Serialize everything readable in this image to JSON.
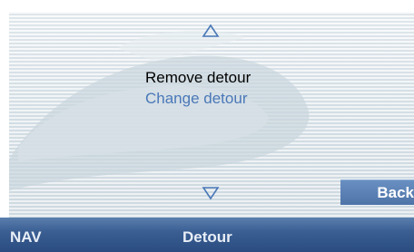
{
  "navigation": {
    "scroll_up_icon": "triangle-up-outline",
    "scroll_down_icon": "triangle-down-outline"
  },
  "menu": {
    "items": [
      {
        "label": "Remove detour",
        "state": "selected"
      },
      {
        "label": "Change detour",
        "state": "unselected"
      }
    ]
  },
  "back_button": {
    "label": "Back"
  },
  "status_bar": {
    "mode": "NAV",
    "title": "Detour"
  },
  "colors": {
    "selected_text": "#000000",
    "option_text": "#4a78b8",
    "accent_button": "#5a80b4",
    "status_bar": "#3b5f93",
    "arrow": "#4a78b8"
  }
}
